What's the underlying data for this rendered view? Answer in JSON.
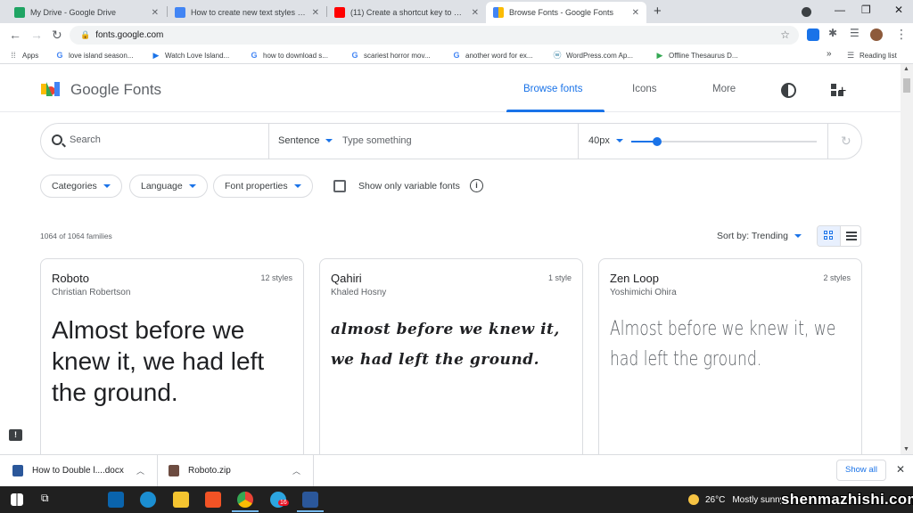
{
  "browser": {
    "tabs": [
      {
        "title": "My Drive - Google Drive",
        "favicon_color": "#1fa463"
      },
      {
        "title": "How to create new text styles in …",
        "favicon_color": "#4285f4"
      },
      {
        "title": "(11) Create a shortcut key to dou…",
        "favicon_color": "#ff0000"
      },
      {
        "title": "Browse Fonts - Google Fonts",
        "favicon_color": "#4285f4"
      }
    ],
    "url": "fonts.google.com",
    "bookmarks": [
      {
        "label": "Apps",
        "icon": "apps-grid-icon"
      },
      {
        "label": "love island season...",
        "icon": "google-icon"
      },
      {
        "label": "Watch Love Island...",
        "icon": "play-icon"
      },
      {
        "label": "how to download s...",
        "icon": "google-icon"
      },
      {
        "label": "scariest horror mov...",
        "icon": "google-icon"
      },
      {
        "label": "another word for ex...",
        "icon": "google-icon"
      },
      {
        "label": "WordPress.com Ap...",
        "icon": "wordpress-icon"
      },
      {
        "label": "Offline Thesaurus D...",
        "icon": "play-store-icon"
      }
    ],
    "bookmarks_overflow": "»",
    "reading_list": "Reading list"
  },
  "header": {
    "brand": "Google Fonts",
    "nav": [
      "Browse fonts",
      "Icons",
      "More"
    ],
    "active_nav": "Browse fonts"
  },
  "search": {
    "placeholder": "Search",
    "preview_mode": "Sentence",
    "preview_placeholder": "Type something",
    "font_size": "40px",
    "font_size_slider": 0.14
  },
  "filters": {
    "chips": [
      "Categories",
      "Language",
      "Font properties"
    ],
    "variable_label": "Show only variable fonts",
    "variable_checked": false
  },
  "results": {
    "count_text": "1064 of 1064 families",
    "sort_label": "Sort by: Trending"
  },
  "cards": [
    {
      "name": "Roboto",
      "author": "Christian Robertson",
      "styles": "12 styles",
      "sample": "Almost before we knew it, we had left the ground."
    },
    {
      "name": "Qahiri",
      "author": "Khaled Hosny",
      "styles": "1 style",
      "sample": "almost before we knew it, we had left the ground."
    },
    {
      "name": "Zen Loop",
      "author": "Yoshimichi Ohira",
      "styles": "2 styles",
      "sample": "Almost before we knew it, we had left the ground."
    }
  ],
  "downloads": {
    "items": [
      {
        "name": "How to Double l....docx",
        "icon_color": "#2b579a"
      },
      {
        "name": "Roboto.zip",
        "icon_color": "#6d4c41"
      }
    ],
    "show_all": "Show all"
  },
  "taskbar": {
    "weather_temp": "26°C",
    "weather_text": "Mostly sunny",
    "watermark": "shenmazhishi.com",
    "badge": "16"
  },
  "colors": {
    "accent": "#1a73e8",
    "chrome_tab_bg": "#dee1e6",
    "taskbar": "#202020"
  }
}
